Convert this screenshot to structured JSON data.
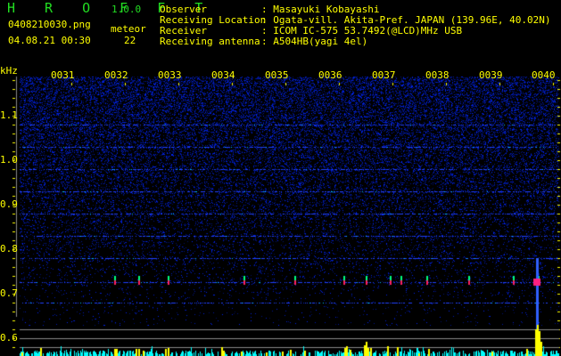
{
  "app": {
    "name": "H R O F F T",
    "version": "1.0.0"
  },
  "file": {
    "name": "0408210030.png",
    "datetime": "04.08.21 00:30"
  },
  "meteor": {
    "label": "meteor",
    "count": "22"
  },
  "info": {
    "observer_label": "Observer",
    "observer": ": Masayuki Kobayashi",
    "location_label": "Receiving Location",
    "location": ": Ogata-vill. Akita-Pref. JAPAN (139.96E, 40.02N)",
    "receiver_label": "Receiver",
    "receiver": ": ICOM IC-575 53.7492(@LCD)MHz USB",
    "antenna_label": "Receiving antenna",
    "antenna": ": A504HB(yagi 4el)"
  },
  "axis": {
    "unit": "kHz",
    "time_labels": [
      "0031",
      "0032",
      "0033",
      "0034",
      "0035",
      "0036",
      "0037",
      "0038",
      "0039",
      "0040"
    ],
    "freq_labels": [
      "1.1",
      "1.0",
      "0.9",
      "0.8",
      "0.7",
      "0.6"
    ]
  },
  "colors": {
    "text": "#ffff00",
    "title": "#22dd22",
    "noise": "#1020c0",
    "bar": "#ffff00",
    "level": "#00ffff"
  }
}
